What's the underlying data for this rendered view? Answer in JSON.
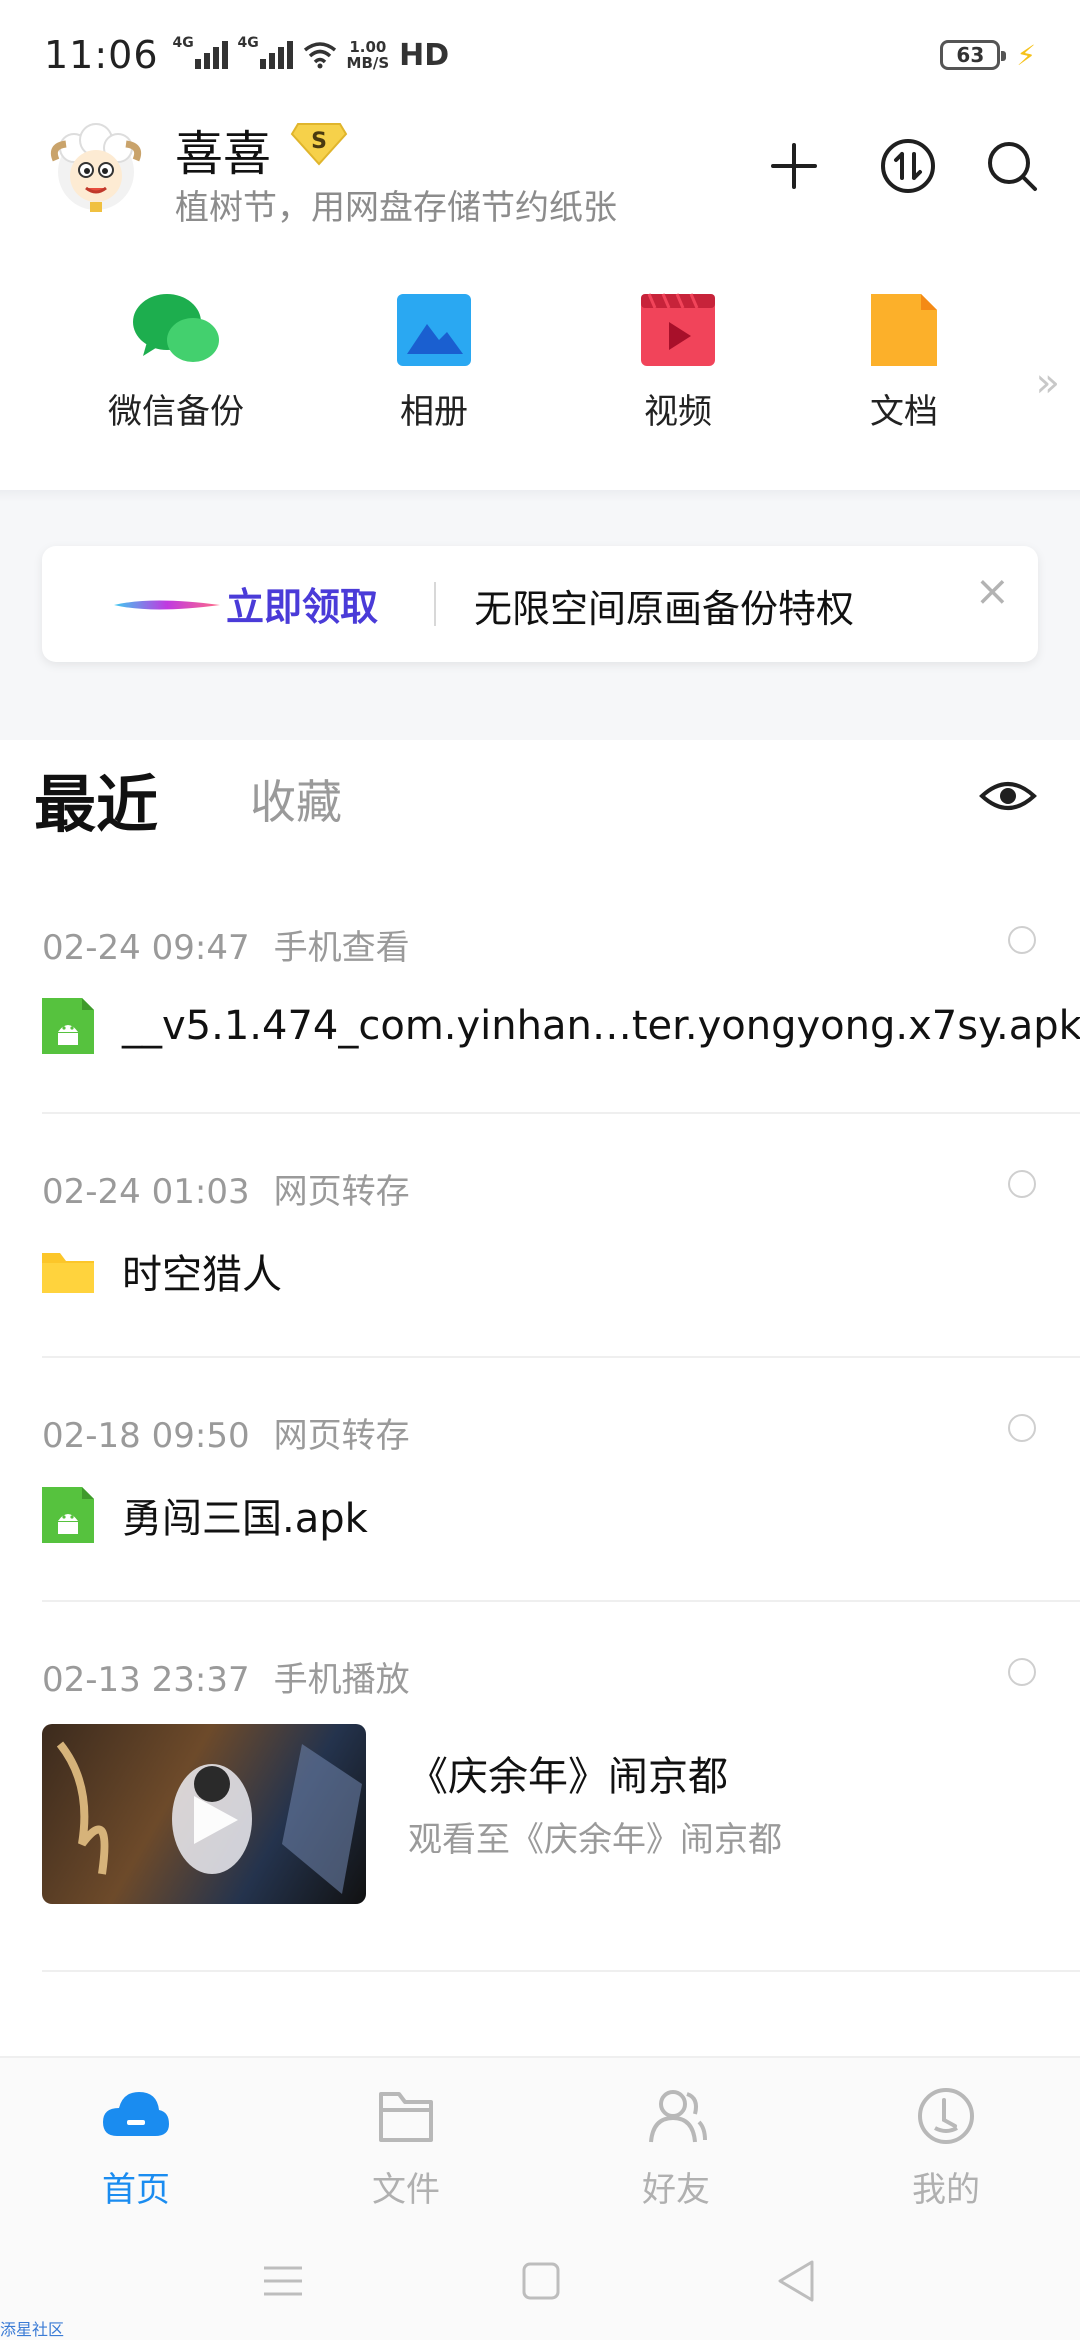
{
  "status_bar": {
    "time": "11:06",
    "net1": "4G",
    "net2": "4G",
    "speed_value": "1.00",
    "speed_unit": "MB/S",
    "hd": "HD",
    "battery": "63"
  },
  "header": {
    "user_name": "喜喜",
    "vip_label": "S",
    "subtitle": "植树节，用网盘存储节约纸张"
  },
  "quick_entries": [
    {
      "label": "微信备份",
      "icon": "wechat-backup-icon"
    },
    {
      "label": "相册",
      "icon": "album-icon"
    },
    {
      "label": "视频",
      "icon": "video-icon"
    },
    {
      "label": "文档",
      "icon": "document-icon"
    }
  ],
  "quick_more": "»",
  "banner": {
    "action": "立即领取",
    "text": "无限空间原画备份特权",
    "close": "×"
  },
  "tabs": {
    "recent": "最近",
    "favorites": "收藏"
  },
  "entries": [
    {
      "date": "02-24 09:47",
      "source": "手机查看",
      "title": "__v5.1.474_com.yinhan…ter.yongyong.x7sy.apk",
      "type": "apk"
    },
    {
      "date": "02-24 01:03",
      "source": "网页转存",
      "title": "时空猎人",
      "type": "folder"
    },
    {
      "date": "02-18 09:50",
      "source": "网页转存",
      "title": "勇闯三国.apk",
      "type": "apk"
    },
    {
      "date": "02-13 23:37",
      "source": "手机播放",
      "title": "《庆余年》闹京都",
      "subtitle": "观看至《庆余年》闹京都",
      "type": "video"
    }
  ],
  "bottom_nav": [
    {
      "label": "首页",
      "active": true
    },
    {
      "label": "文件",
      "active": false
    },
    {
      "label": "好友",
      "active": false
    },
    {
      "label": "我的",
      "active": false
    }
  ],
  "watermark": "添星社区",
  "colors": {
    "accent": "#1a8cf0",
    "banner_action": "#4a3bd8",
    "apk_green": "#56c23e",
    "folder_yellow": "#fcc629"
  }
}
